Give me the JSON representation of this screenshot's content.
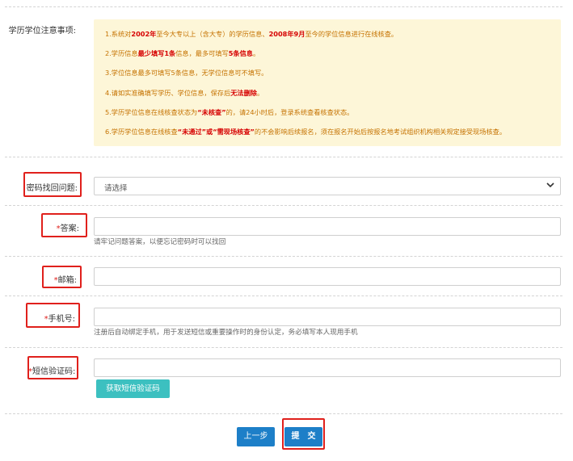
{
  "notice": {
    "label": "学历学位注意事项:",
    "items": [
      {
        "parts": [
          {
            "t": "1.系统对",
            "b": false
          },
          {
            "t": "2002年",
            "b": true
          },
          {
            "t": "至今大专以上（含大专）的学历信息、",
            "b": false
          },
          {
            "t": "2008年9月",
            "b": true
          },
          {
            "t": "至今的学位信息进行在线核查。",
            "b": false
          }
        ]
      },
      {
        "parts": [
          {
            "t": "2.学历信息",
            "b": false
          },
          {
            "t": "最少填写1条",
            "b": true
          },
          {
            "t": "信息，最多可填写",
            "b": false
          },
          {
            "t": "5条信息",
            "b": true
          },
          {
            "t": "。",
            "b": false
          }
        ]
      },
      {
        "parts": [
          {
            "t": "3.学位信息最多可填写5条信息，无学位信息可不填写。",
            "b": false
          }
        ]
      },
      {
        "parts": [
          {
            "t": "4.请如实准确填写学历、学位信息，保存后",
            "b": false
          },
          {
            "t": "无法删除",
            "b": true
          },
          {
            "t": "。",
            "b": false
          }
        ]
      },
      {
        "parts": [
          {
            "t": "5.学历学位信息在线核查状态为",
            "b": false
          },
          {
            "t": "“未核查”",
            "b": true
          },
          {
            "t": "的，请24小时后，登录系统查看核查状态。",
            "b": false
          }
        ]
      },
      {
        "parts": [
          {
            "t": "6.学历学位信息在线核查",
            "b": false
          },
          {
            "t": "“未通过”或“需现场核查”",
            "b": true
          },
          {
            "t": "的不会影响后续报名，须在报名开始后按报名地考试组织机构相关规定接受现场核查。",
            "b": false
          }
        ]
      }
    ]
  },
  "form": {
    "question": {
      "label": "密码找回问题:",
      "value": "请选择"
    },
    "answer": {
      "star": "*",
      "label": "答案:",
      "value": "",
      "hint": "请牢记问题答案，以便忘记密码时可以找回"
    },
    "email": {
      "star": "*",
      "label": "邮箱:",
      "value": ""
    },
    "phone": {
      "star": "*",
      "label": "手机号:",
      "value": "",
      "hint": "注册后自动绑定手机，用于发送短信或重要操作时的身份认定，务必填写本人现用手机"
    },
    "sms": {
      "star": "*",
      "label": "短信验证码:",
      "value": "",
      "button": "获取短信验证码"
    }
  },
  "actions": {
    "prev": "上一步",
    "submit": "提　交"
  },
  "colors": {
    "notice_bg": "#fdf6d8",
    "notice_text": "#c57200",
    "emphasis": "#d60000",
    "highlight_box": "#e0201c",
    "sms_button": "#3cc0c0",
    "primary_button": "#1d7fc8"
  }
}
